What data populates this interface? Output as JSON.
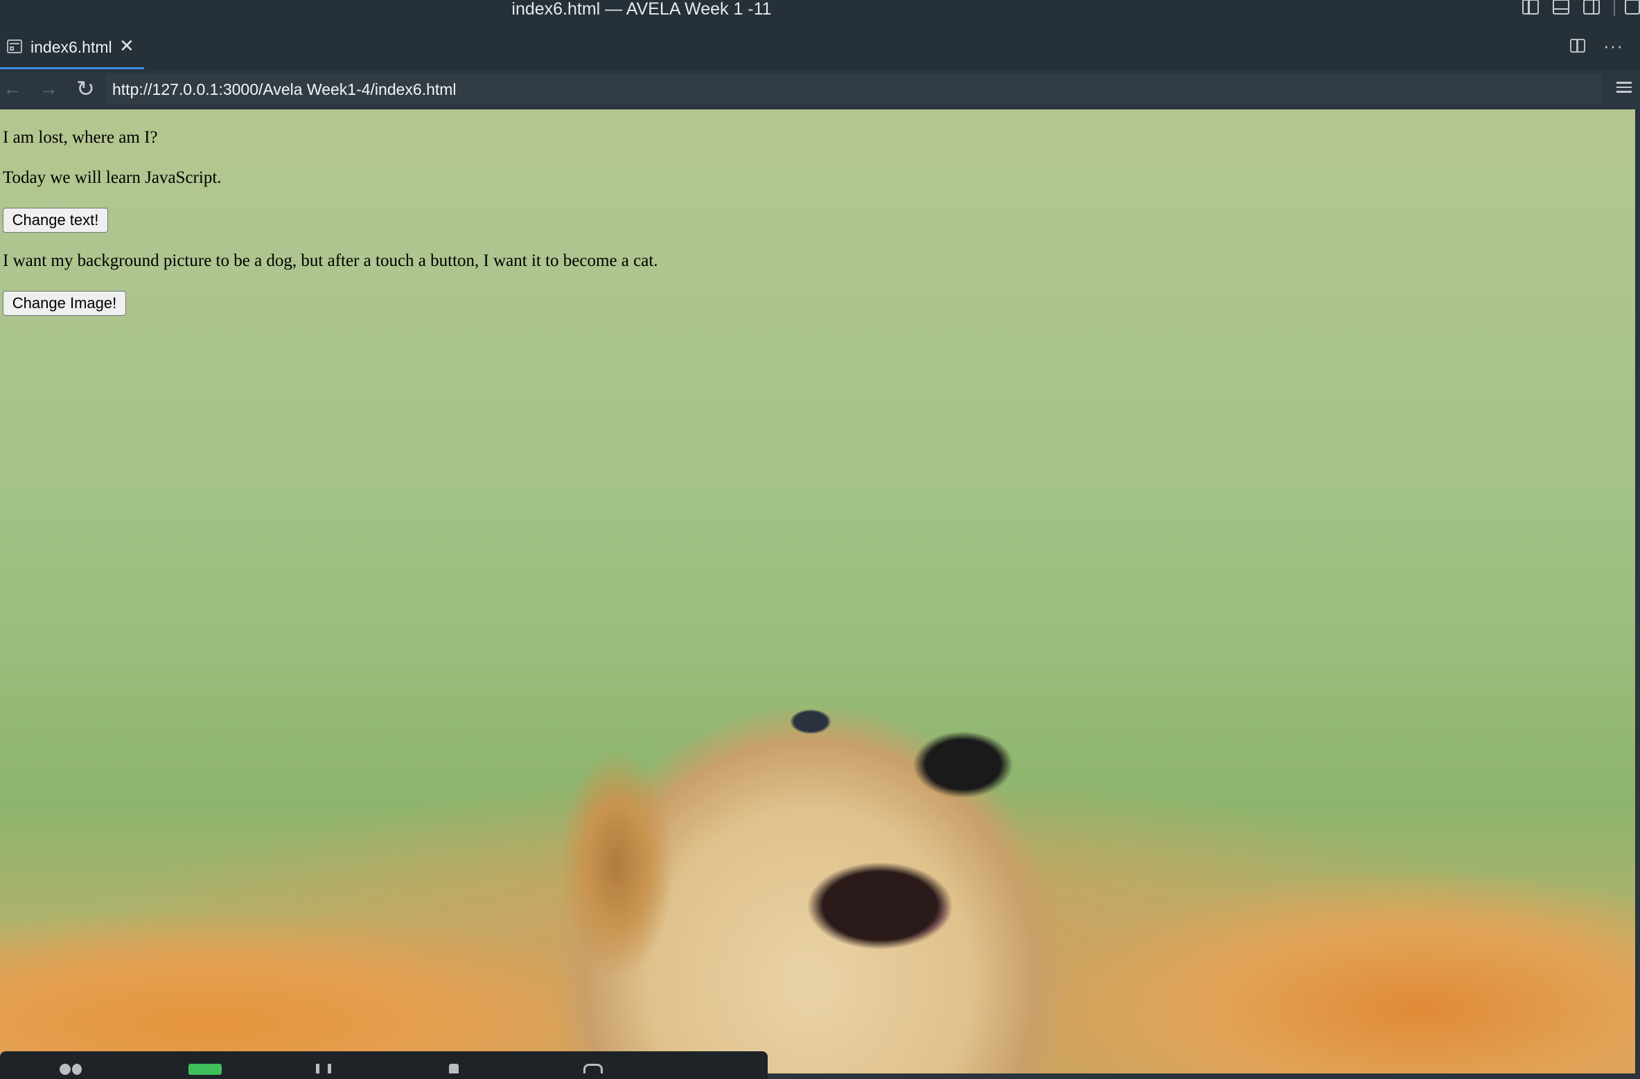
{
  "window": {
    "title": "index6.html — AVELA Week 1 -11"
  },
  "tab": {
    "label": "index6.html",
    "close_glyph": "✕"
  },
  "tab_actions": {
    "more_glyph": "···"
  },
  "nav": {
    "back_glyph": "←",
    "forward_glyph": "→",
    "reload_glyph": "↻",
    "url": "http://127.0.0.1:3000/Avela Week1-4/index6.html"
  },
  "page": {
    "line1": "I am lost, where am I?",
    "line2": "Today we will learn JavaScript.",
    "change_text_button": "Change text!",
    "line3": "I want my background picture to be a dog, but after a touch a button, I want it to become a cat.",
    "change_image_button": "Change Image!",
    "background": "puppy-background-image"
  },
  "icons": {
    "layout_left": "toggle-primary-sidebar-icon",
    "layout_bottom": "toggle-panel-icon",
    "layout_right": "toggle-secondary-sidebar-icon",
    "layout_custom": "customize-layout-icon",
    "tab": "preview-icon",
    "split": "split-editor-icon",
    "more": "more-actions-icon",
    "menu": "menu-icon"
  },
  "colors": {
    "chrome_bg": "#253039",
    "tab_active_border": "#3d8ee6",
    "button_bg": "#efefef"
  }
}
